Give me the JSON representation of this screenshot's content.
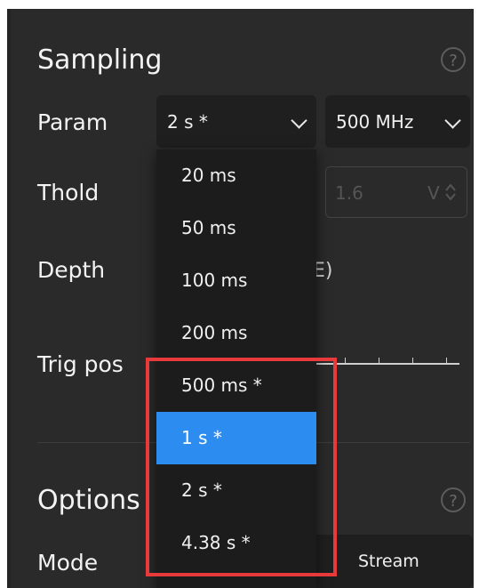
{
  "sampling": {
    "title": "Sampling",
    "help_glyph": "?",
    "param_label": "Param",
    "param_value": "2 s *",
    "freq_value": "500 MHz",
    "thold_label": "Thold",
    "thold_value": "1.6",
    "thold_unit": "V",
    "depth_label": "Depth",
    "depth_suffix": "E)",
    "trig_label": "Trig pos"
  },
  "options": {
    "title": "Options",
    "help_glyph": "?",
    "mode_label": "Mode",
    "mode_stream": "Stream"
  },
  "dropdown": {
    "items": [
      {
        "label": "20 ms",
        "selected": false
      },
      {
        "label": "50 ms",
        "selected": false
      },
      {
        "label": "100 ms",
        "selected": false
      },
      {
        "label": "200 ms",
        "selected": false
      },
      {
        "label": "500 ms *",
        "selected": false
      },
      {
        "label": "1 s *",
        "selected": true
      },
      {
        "label": "2 s *",
        "selected": false
      },
      {
        "label": "4.38 s *",
        "selected": false
      }
    ]
  },
  "colors": {
    "panel_bg": "#2a2a2a",
    "accent": "#2d8cf0",
    "highlight": "#e83a3a"
  }
}
